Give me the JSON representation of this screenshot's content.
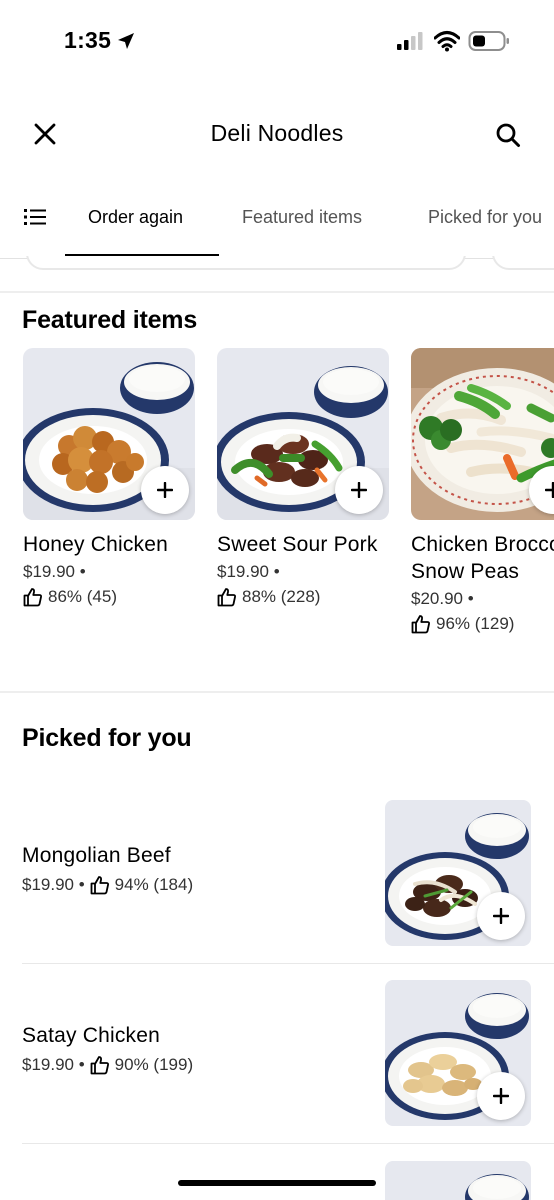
{
  "status_bar": {
    "time": "1:35"
  },
  "header": {
    "title": "Deli Noodles"
  },
  "tabs": [
    {
      "label": "Order again"
    },
    {
      "label": "Featured items"
    },
    {
      "label": "Picked for you"
    }
  ],
  "featured": {
    "title": "Featured items",
    "items": [
      {
        "name": "Honey Chicken",
        "price": "$19.90 •",
        "rating": "86% (45)"
      },
      {
        "name": "Sweet Sour Pork",
        "price": "$19.90 •",
        "rating": "88% (228)"
      },
      {
        "name": "Chicken Broccoli Snow Peas",
        "price": "$20.90 •",
        "rating": "96% (129)"
      }
    ]
  },
  "picked": {
    "title": "Picked for you",
    "items": [
      {
        "name": "Mongolian Beef",
        "price": "$19.90 •",
        "rating": "94% (184)"
      },
      {
        "name": "Satay Chicken",
        "price": "$19.90 •",
        "rating": "90% (199)"
      }
    ]
  },
  "colors": {
    "accent": "#000000",
    "plate_blue": "#24386a"
  }
}
